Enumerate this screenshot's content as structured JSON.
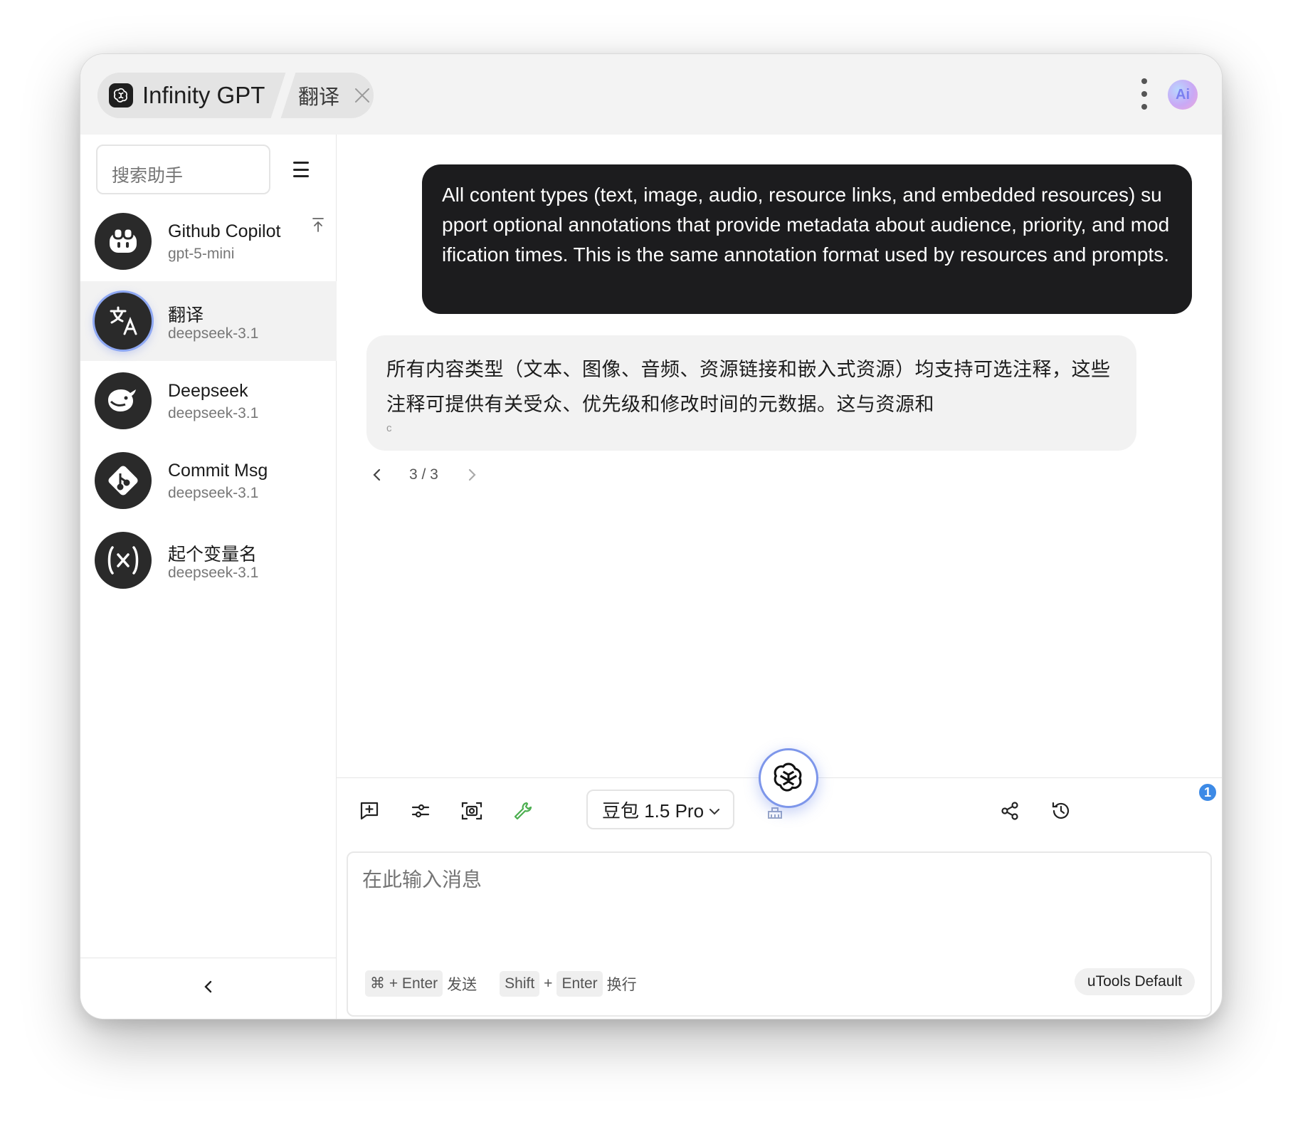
{
  "titlebar": {
    "app_name": "Infinity GPT",
    "current_tab": "翻译",
    "icons": [
      "openai-logo-icon",
      "close-icon",
      "more-vertical-icon",
      "ai-avatar-icon"
    ],
    "avatar_text": "Ai"
  },
  "sidebar": {
    "search_placeholder": "搜索助手",
    "assistants": [
      {
        "name": "Github Copilot",
        "model": "gpt-5-mini",
        "icon": "copilot-icon",
        "pinned": true
      },
      {
        "name": "翻译",
        "model": "deepseek-3.1",
        "icon": "translate-icon",
        "active": true
      },
      {
        "name": "Deepseek",
        "model": "deepseek-3.1",
        "icon": "whale-icon"
      },
      {
        "name": "Commit Msg",
        "model": "deepseek-3.1",
        "icon": "git-icon"
      },
      {
        "name": "起个变量名",
        "model": "deepseek-3.1",
        "icon": "variable-icon"
      }
    ]
  },
  "chat": {
    "user_message": "All content types (text, image, audio, resource links, and embedded resources) support optional annotations that provide metadata about audience, priority, and modification times. This is the same annotation format used by resources and prompts.",
    "ai_message": "所有内容类型（文本、图像、音频、资源链接和嵌入式资源）均支持可选注释，这些注释可提供有关受众、优先级和修改时间的元数据。这与资源和",
    "ai_cursor": "c",
    "pager": "3 / 3"
  },
  "toolbar": {
    "model": "豆包 1.5 Pro",
    "history_badge": "1"
  },
  "input": {
    "placeholder": "在此输入消息",
    "hint_send_key": "⌘ + Enter",
    "hint_send_label": "发送",
    "hint_shift": "Shift",
    "hint_plus": "+",
    "hint_enter": "Enter",
    "hint_newline_label": "换行",
    "preset": "uTools Default"
  },
  "colors": {
    "user_bubble": "#1c1c1e",
    "ai_bubble": "#f2f2f2",
    "active_ring": "#7d96ea",
    "wrench_green": "#4caf50",
    "badge_blue": "#3d8ae6"
  }
}
